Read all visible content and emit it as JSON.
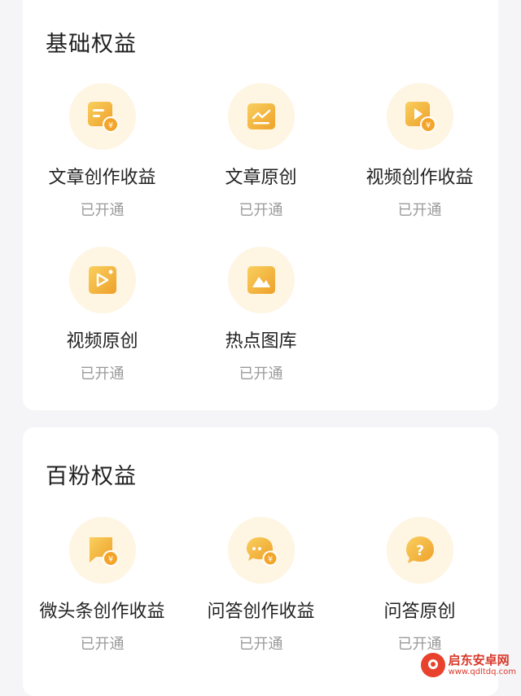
{
  "colors": {
    "accent": "#f4b93c",
    "accent_dark": "#e79a1b",
    "circle_bg": "#fef5e3",
    "status": "#9a9a9a"
  },
  "sections": [
    {
      "title": "基础权益",
      "items": [
        {
          "label": "文章创作收益",
          "status": "已开通",
          "icon": "article-income-icon"
        },
        {
          "label": "文章原创",
          "status": "已开通",
          "icon": "article-original-icon"
        },
        {
          "label": "视频创作收益",
          "status": "已开通",
          "icon": "video-income-icon"
        },
        {
          "label": "视频原创",
          "status": "已开通",
          "icon": "video-original-icon"
        },
        {
          "label": "热点图库",
          "status": "已开通",
          "icon": "gallery-icon"
        }
      ]
    },
    {
      "title": "百粉权益",
      "items": [
        {
          "label": "微头条创作收益",
          "status": "已开通",
          "icon": "micro-post-income-icon"
        },
        {
          "label": "问答创作收益",
          "status": "已开通",
          "icon": "qa-income-icon"
        },
        {
          "label": "问答原创",
          "status": "已开通",
          "icon": "qa-original-icon"
        }
      ]
    }
  ],
  "watermark": {
    "name": "启东安卓网",
    "url": "www.qdltdq.com"
  }
}
